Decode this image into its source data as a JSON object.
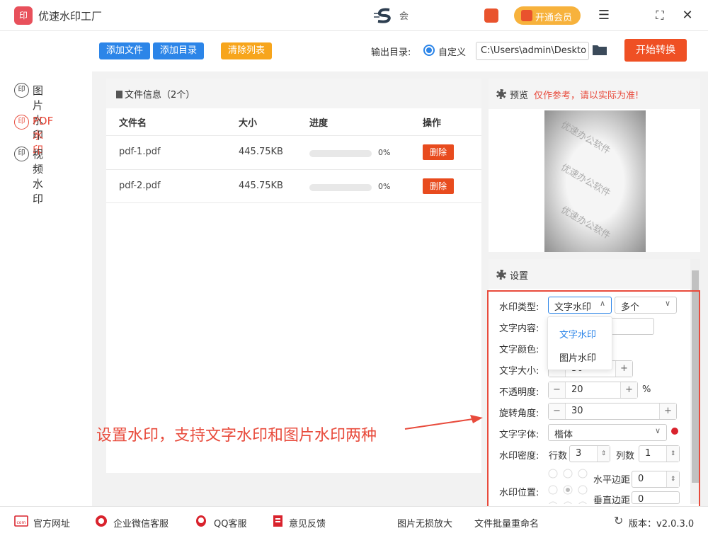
{
  "title_bar": {
    "logo_text": "印",
    "app_title": "优速水印工厂",
    "user_name": "会",
    "vip_label": "开通会员",
    "menu_icon": "menu-icon",
    "fullscreen_icon": "fullscreen-icon",
    "close_icon": "close-icon"
  },
  "sidebar": {
    "items": [
      {
        "icon_text": "印",
        "label": "图片水印",
        "active": false
      },
      {
        "icon_text": "印",
        "label": "PDF水印",
        "active": true
      },
      {
        "icon_text": "印",
        "label": "视频水印",
        "active": false
      }
    ]
  },
  "toolbar": {
    "add_file": "添加文件",
    "add_dir": "添加目录",
    "clear_list": "清除列表",
    "output_label": "输出目录:",
    "radio_label": "自定义",
    "output_path": "C:\\Users\\admin\\Deskto",
    "start": "开始转换"
  },
  "file_panel": {
    "title": "文件信息（2个）",
    "columns": [
      "文件名",
      "大小",
      "进度",
      "操作"
    ],
    "rows": [
      {
        "name": "pdf-1.pdf",
        "size": "445.75KB",
        "progress": "0%",
        "progress_value": 0,
        "action": "删除"
      },
      {
        "name": "pdf-2.pdf",
        "size": "445.75KB",
        "progress": "0%",
        "progress_value": 0,
        "action": "删除"
      }
    ]
  },
  "preview": {
    "title": "预览",
    "note": "仅作参考，请以实际为准!",
    "watermark_text": "优速办公软件"
  },
  "settings": {
    "title": "设置",
    "type_label": "水印类型:",
    "type_value": "文字水印",
    "count_value": "多个",
    "type_options": [
      "文字水印",
      "图片水印"
    ],
    "content_label": "文字内容:",
    "color_label": "文字颜色:",
    "size_label": "文字大小:",
    "size_value": "30",
    "opacity_label": "不透明度:",
    "opacity_value": "20",
    "opacity_unit": "%",
    "rotate_label": "旋转角度:",
    "rotate_value": "30",
    "font_label": "文字字体:",
    "font_value": "楷体",
    "density_label": "水印密度:",
    "rows_label": "行数",
    "rows_value": "3",
    "cols_label": "列数",
    "cols_value": "1",
    "position_label": "水印位置:",
    "h_margin_label": "水平边距",
    "h_margin_value": "0",
    "v_margin_label": "垂直边距",
    "v_margin_value": "0"
  },
  "annotation": "设置水印，支持文字水印和图片水印两种",
  "bottom_bar": {
    "website": "官方网址",
    "wechat": "企业微信客服",
    "qq": "QQ客服",
    "feedback": "意见反馈",
    "enlarge": "图片无损放大",
    "rename": "文件批量重命名",
    "version": "版本：v2.0.3.0"
  },
  "colors": {
    "accent_red": "#e84b3c",
    "blue": "#2c85e8",
    "orange": "#f7a51c",
    "start": "#ef5024",
    "vip": "#f7b23c"
  }
}
